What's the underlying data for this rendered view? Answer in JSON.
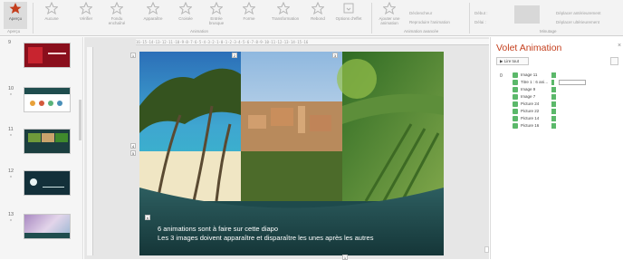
{
  "ribbon": {
    "buttons": [
      {
        "label": "Aperçu",
        "state": "active"
      },
      {
        "label": "Aucune"
      },
      {
        "label": "Vérifier"
      },
      {
        "label": "Fondu enchaîné"
      },
      {
        "label": "Apparaître"
      },
      {
        "label": "Croisée"
      },
      {
        "label": "Entrée brusque"
      },
      {
        "label": "Forme"
      },
      {
        "label": "Transformation"
      },
      {
        "label": "Rebond"
      }
    ],
    "options_label": "Options d'effet",
    "add_animation_label": "Ajouter une animation",
    "trigger_label": "Déclencheur",
    "painter_label": "Reproduire l'animation",
    "start_label": "Début :",
    "delay_label": "Délai :",
    "move_earlier_label": "Déplacer antérieurement",
    "move_later_label": "Déplacer ultérieurement",
    "groups": {
      "preview": "Aperçu",
      "animation": "Animation",
      "advanced": "Animation avancée",
      "timing": "Minutage"
    }
  },
  "thumbnails": [
    {
      "number": "9",
      "star": "*"
    },
    {
      "number": "10",
      "star": "*"
    },
    {
      "number": "11",
      "star": "*"
    },
    {
      "number": "12",
      "star": "*"
    },
    {
      "number": "13",
      "star": "*"
    }
  ],
  "ruler_text": "16·15·14·13·12·11·10·9·8·7·6·5·4·3·2·1·0·1·2·3·4·5·6·7·8·9·10·11·12·13·14·15·16",
  "slide": {
    "line1": "6 animations sont à faire sur cette diapo",
    "line2": "Les 3 images doivent apparaître et disparaître les unes après les autres",
    "tags": {
      "top_left": "1",
      "top_mid": "2",
      "top_right": "3",
      "left_a": "4",
      "left_b": "5",
      "text_tag": "6",
      "bottom": "1"
    }
  },
  "animation_pane": {
    "title": "Volet Animation",
    "play_button": "Lire tout",
    "index": "0",
    "items": [
      {
        "name": "Image 11",
        "selected": false
      },
      {
        "name": "Titre 1 : 6 ani…",
        "selected": true
      },
      {
        "name": "Image 9",
        "selected": false
      },
      {
        "name": "Image 7",
        "selected": false
      },
      {
        "name": "Picture 24",
        "selected": false
      },
      {
        "name": "Picture 22",
        "selected": false
      },
      {
        "name": "Picture 14",
        "selected": false
      },
      {
        "name": "Picture 16",
        "selected": false
      }
    ],
    "close": "×",
    "accent_color": "#c43e1c",
    "effect_color": "#5bb86a"
  }
}
